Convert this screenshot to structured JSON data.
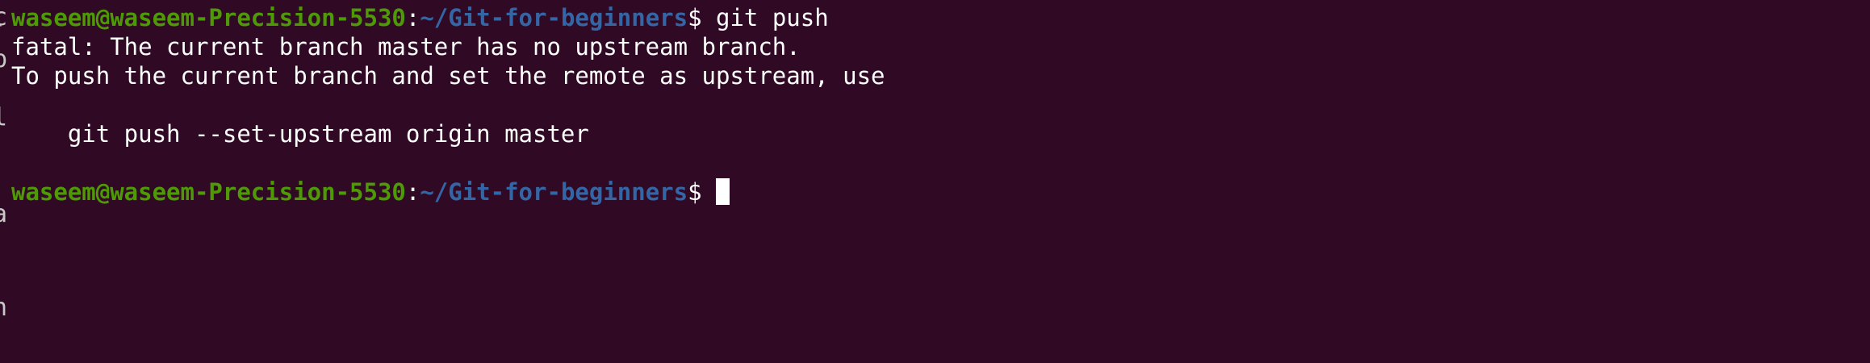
{
  "terminal": {
    "colors": {
      "background": "#300a24",
      "user_host": "#4e9a06",
      "path": "#3465a4",
      "text": "#ffffff"
    },
    "left_edge_glyphs": [
      "c",
      "`",
      "p",
      "l",
      "a",
      "h"
    ],
    "prompt": {
      "user_host": "waseem@waseem-Precision-5530",
      "separator": ":",
      "path": "~/Git-for-beginners",
      "symbol": "$ "
    },
    "command": "git push",
    "output": [
      "fatal: The current branch master has no upstream branch.",
      "To push the current branch and set the remote as upstream, use",
      "",
      "    git push --set-upstream origin master",
      ""
    ]
  }
}
